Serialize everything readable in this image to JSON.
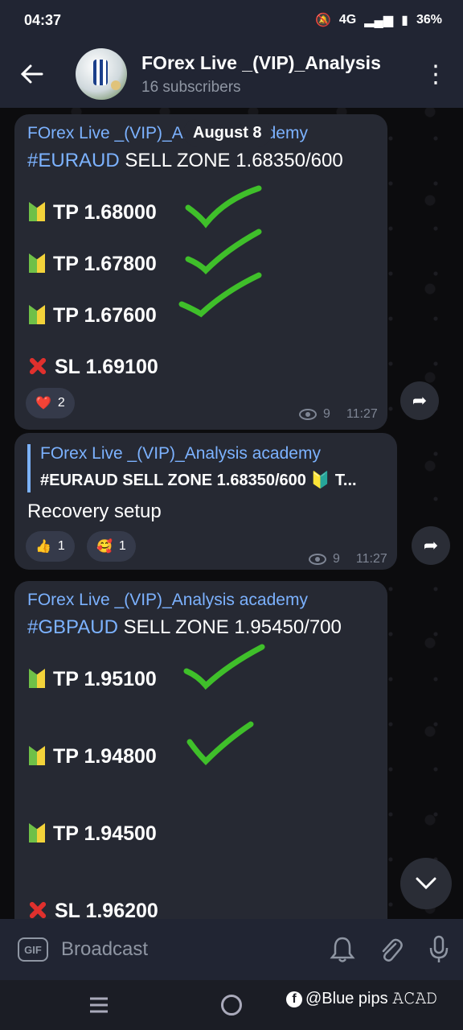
{
  "status": {
    "time": "04:37",
    "network": "4G",
    "battery": "36%"
  },
  "header": {
    "title": "FOrex Live _(VIP)_Analysis",
    "subtitle": "16 subscribers"
  },
  "date_chip": "August 8",
  "messages": [
    {
      "sender": "FOrex Live _(VIP)_Analysis academy",
      "pair": "#EURAUD",
      "headline": " SELL ZONE 1.68350/600",
      "lines": [
        "TP 1.68000",
        "TP 1.67800",
        "TP 1.67600",
        "SL 1.69100"
      ],
      "reaction": {
        "emoji": "❤️",
        "count": "2"
      },
      "views": "9",
      "time": "11:27"
    },
    {
      "quote_sender": "FOrex Live _(VIP)_Analysis academy",
      "quote_text": "#EURAUD SELL ZONE 1.68350/600 🔰 T...",
      "text": "Recovery setup",
      "reactions": [
        {
          "emoji": "👍",
          "count": "1"
        },
        {
          "emoji": "🥰",
          "count": "1"
        }
      ],
      "views": "9",
      "time": "11:27"
    },
    {
      "sender": "FOrex Live _(VIP)_Analysis academy",
      "pair": "#GBPAUD",
      "headline": " SELL ZONE 1.95450/700",
      "lines": [
        "TP 1.95100",
        "TP 1.94800",
        "TP 1.94500",
        "SL 1.96200"
      ]
    }
  ],
  "input": {
    "placeholder": "Broadcast",
    "gif_label": "GIF"
  },
  "watermark": "@Blue pips 𝙰𝙲𝙰𝙳"
}
